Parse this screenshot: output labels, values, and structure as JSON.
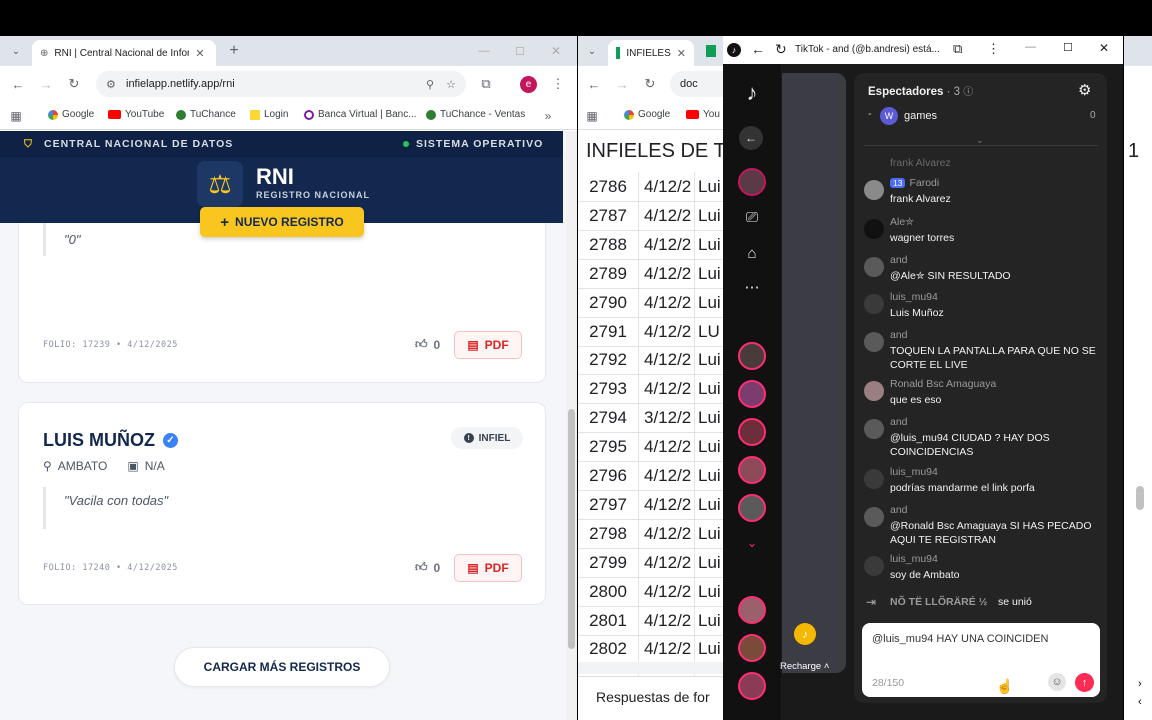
{
  "left_browser": {
    "tab_title": "RNI | Central Nacional de Infor",
    "url": "infielapp.netlify.app/rni",
    "profile_letter": "e",
    "bookmarks": [
      "Google",
      "YouTube",
      "TuChance",
      "Login",
      "Banca Virtual | Banc...",
      "TuChance - Ventas"
    ]
  },
  "rni": {
    "top_left": "CENTRAL NACIONAL DE DATOS",
    "top_right": "SISTEMA OPERATIVO",
    "logo_title": "RNI",
    "logo_subtitle": "REGISTRO NACIONAL",
    "new_button": "NUEVO REGISTRO",
    "load_more": "CARGAR MÁS REGISTROS",
    "records": [
      {
        "quote": "\"0\"",
        "folio": "FOLIO: 17239 • 4/12/2025",
        "likes": "0",
        "pdf": "PDF"
      },
      {
        "name": "LUIS MUÑOZ",
        "badge": "INFIEL",
        "city": "AMBATO",
        "job": "N/A",
        "quote": "\"Vacila con todas\"",
        "folio": "FOLIO: 17240 • 4/12/2025",
        "likes": "0",
        "pdf": "PDF"
      }
    ]
  },
  "middle_browser": {
    "tab_title": "INFIELES",
    "url_fragment": "doc",
    "bookmarks": [
      "Google",
      "You"
    ],
    "sheet_title": "INFIELES DE T",
    "rows": [
      [
        "2786",
        "4/12/2",
        "Lui"
      ],
      [
        "2787",
        "4/12/2",
        "Lui"
      ],
      [
        "2788",
        "4/12/2",
        "Lui"
      ],
      [
        "2789",
        "4/12/2",
        "Lui"
      ],
      [
        "2790",
        "4/12/2",
        "Lui"
      ],
      [
        "2791",
        "4/12/2",
        "LU"
      ],
      [
        "2792",
        "4/12/2",
        "Lui"
      ],
      [
        "2793",
        "4/12/2",
        "Lui"
      ],
      [
        "2794",
        "3/12/2",
        "Lui"
      ],
      [
        "2795",
        "4/12/2",
        "Lui"
      ],
      [
        "2796",
        "4/12/2",
        "Lui"
      ],
      [
        "2797",
        "4/12/2",
        "Lui"
      ],
      [
        "2798",
        "4/12/2",
        "Lui"
      ],
      [
        "2799",
        "4/12/2",
        "Lui"
      ],
      [
        "2800",
        "4/12/2",
        "Lui"
      ],
      [
        "2801",
        "4/12/2",
        "Lui"
      ],
      [
        "2802",
        "4/12/2",
        "Lui"
      ]
    ],
    "footer": "Respuestas de for"
  },
  "tiktok": {
    "window_title": "TikTok - and (@b.andresi) está...",
    "recharge": "Recharge",
    "viewers_label": "Espectadores",
    "viewers_count": "· 3",
    "top_viewer": "games",
    "top_viewer_score": "0",
    "faded_user": "frank Alvarez",
    "chat": [
      {
        "user": "Farodi",
        "badge": "13",
        "msg": "frank Alvarez",
        "color": "#8a8a8a"
      },
      {
        "user": "Ale✮",
        "msg": "wagner torres",
        "color": "#111"
      },
      {
        "user": "and",
        "msg": "@Ale✮ SIN RESULTADO",
        "color": "#5a5a5a"
      },
      {
        "user": "luis_mu94",
        "msg": "Luis Muñoz",
        "color": "#3a3a3a"
      },
      {
        "user": "and",
        "msg": "TOQUEN LA PANTALLA PARA QUE NO SE CORTE EL LIVE",
        "color": "#5a5a5a"
      },
      {
        "user": "Ronald Bsc Amaguaya",
        "msg": "que es eso",
        "color": "#9a7f80"
      },
      {
        "user": "and",
        "msg": "@luis_mu94 CIUDAD ? HAY DOS COINCIDENCIAS",
        "color": "#5a5a5a"
      },
      {
        "user": "luis_mu94",
        "msg": "podrías mandarme el link porfa",
        "color": "#3a3a3a"
      },
      {
        "user": "and",
        "msg": "@Ronald Bsc Amaguaya SI HAS PECADO AQUI TE REGISTRAN",
        "color": "#5a5a5a"
      },
      {
        "user": "luis_mu94",
        "msg": "soy de Ambato",
        "color": "#3a3a3a"
      }
    ],
    "joined_user": "NÕ TË LLÕRÄRÉ ½",
    "joined_text": "se unió",
    "input_value": "@luis_mu94 HAY UNA COINCIDEN",
    "char_count": "28/150"
  },
  "right_window": {
    "digit": "1"
  }
}
